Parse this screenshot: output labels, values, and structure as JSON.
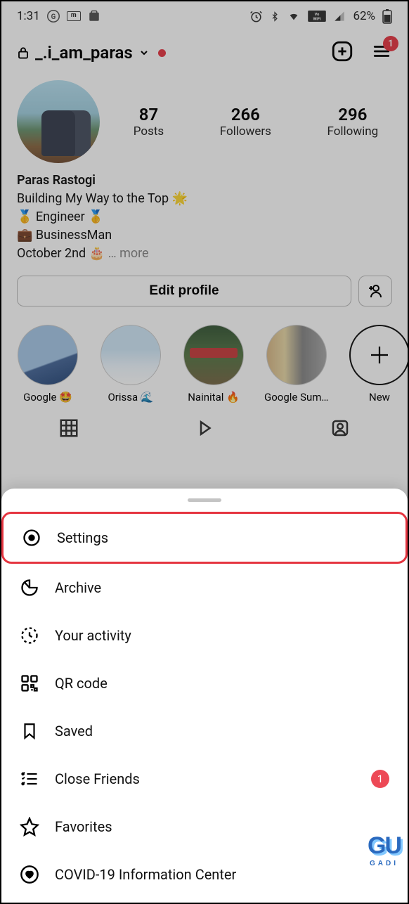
{
  "status": {
    "time": "1:31",
    "battery": "62%"
  },
  "header": {
    "username": "_.i_am_paras",
    "menu_badge": "1"
  },
  "profile": {
    "posts_count": "87",
    "posts_label": "Posts",
    "followers_count": "266",
    "followers_label": "Followers",
    "following_count": "296",
    "following_label": "Following"
  },
  "bio": {
    "name": "Paras Rastogi",
    "line1": "Building My Way to the Top 🌟",
    "line2": "🥇 Engineer 🥇",
    "line3": "💼 BusinessMan",
    "line4": "October 2nd 🎂",
    "more": "… more"
  },
  "actions": {
    "edit_profile": "Edit profile"
  },
  "highlights": [
    {
      "label": "Google 🤩"
    },
    {
      "label": "Orissa 🌊"
    },
    {
      "label": "Nainital 🔥"
    },
    {
      "label": "Google Summi..."
    },
    {
      "label": "New"
    }
  ],
  "menu": {
    "settings": "Settings",
    "archive": "Archive",
    "activity": "Your activity",
    "qr": "QR code",
    "saved": "Saved",
    "close_friends": "Close Friends",
    "close_friends_badge": "1",
    "favorites": "Favorites",
    "covid": "COVID-19 Information Center"
  },
  "watermark": {
    "main": "GU",
    "sub": "GADI"
  }
}
